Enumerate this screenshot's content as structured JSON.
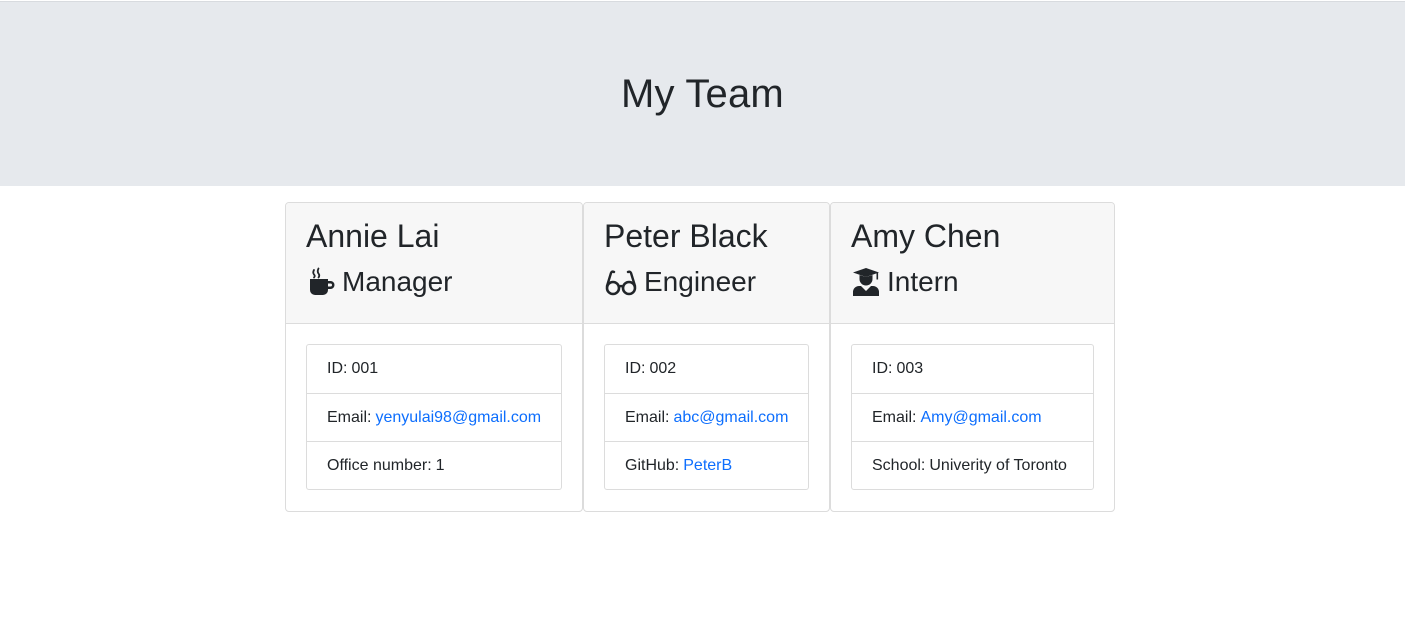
{
  "header": {
    "title": "My Team"
  },
  "employees": [
    {
      "name": "Annie Lai",
      "role": "Manager",
      "role_icon": "mug-icon",
      "id_label": "ID:",
      "id": "001",
      "email_label": "Email:",
      "email": "yenyulai98@gmail.com",
      "extra_label": "Office number:",
      "extra_value": "1"
    },
    {
      "name": "Peter Black",
      "role": "Engineer",
      "role_icon": "glasses-icon",
      "id_label": "ID:",
      "id": "002",
      "email_label": "Email:",
      "email": "abc@gmail.com",
      "extra_label": "GitHub:",
      "extra_value": "PeterB"
    },
    {
      "name": "Amy Chen",
      "role": "Intern",
      "role_icon": "graduate-icon",
      "id_label": "ID:",
      "id": "003",
      "email_label": "Email:",
      "email": "Amy@gmail.com",
      "extra_label": "School:",
      "extra_value": "Univerity of Toronto"
    }
  ],
  "colors": {
    "header_bg": "#e6e9ed",
    "card_header_bg": "#f7f7f7",
    "link": "#0d6efd",
    "text": "#212529"
  }
}
